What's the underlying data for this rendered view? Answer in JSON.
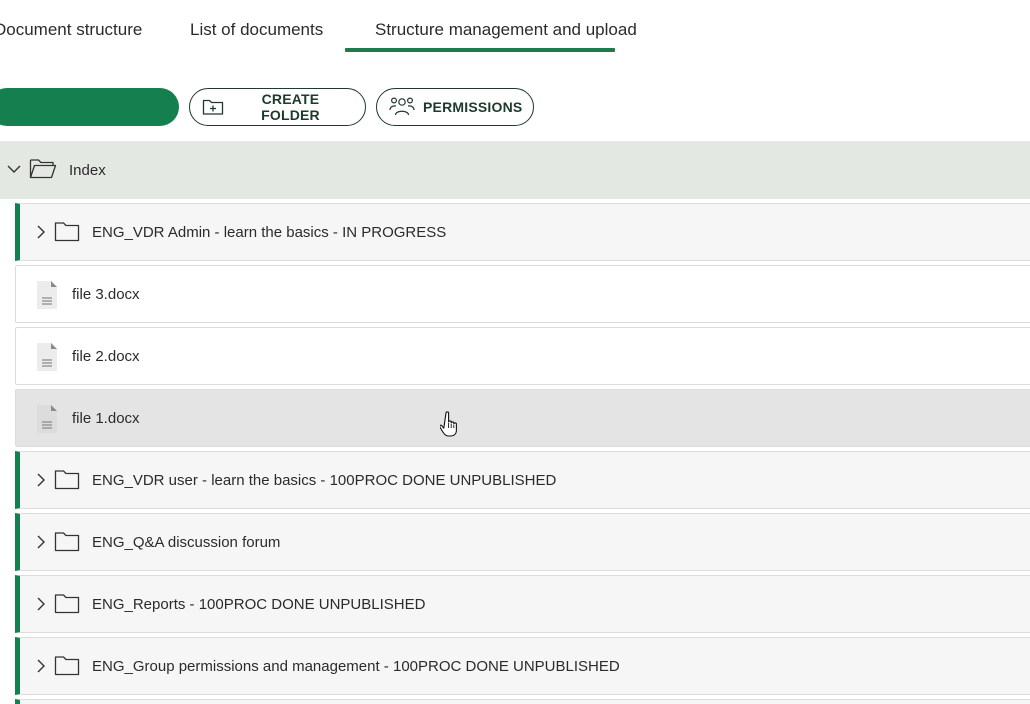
{
  "tabs": [
    {
      "label": "Document structure"
    },
    {
      "label": "List of documents"
    },
    {
      "label": "Structure management and upload"
    }
  ],
  "toolbar": {
    "primary_label": "",
    "create_folder_label": "CREATE FOLDER",
    "permissions_label": "PERMISSIONS"
  },
  "tree": {
    "root_label": "Index",
    "items": [
      {
        "type": "folder",
        "label": "ENG_VDR Admin - learn the basics - IN PROGRESS"
      },
      {
        "type": "file",
        "label": "file 3.docx"
      },
      {
        "type": "file",
        "label": "file 2.docx"
      },
      {
        "type": "file",
        "label": "file 1.docx"
      },
      {
        "type": "folder",
        "label": "ENG_VDR user - learn the basics - 100PROC DONE UNPUBLISHED"
      },
      {
        "type": "folder",
        "label": "ENG_Q&A discussion forum"
      },
      {
        "type": "folder",
        "label": "ENG_Reports - 100PROC DONE UNPUBLISHED"
      },
      {
        "type": "folder",
        "label": "ENG_Group permissions and management - 100PROC DONE UNPUBLISHED"
      }
    ]
  },
  "colors": {
    "accent": "#15804f",
    "root_row_bg": "#e4e8e3",
    "hover_row_bg": "#e4e4e4"
  }
}
